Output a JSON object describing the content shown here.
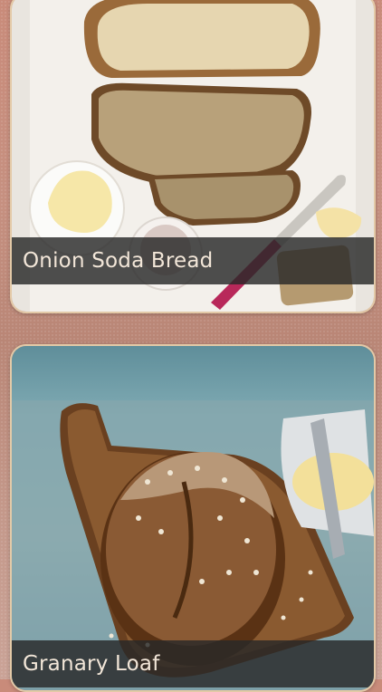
{
  "recipes": [
    {
      "title": "Onion Soda Bread",
      "image_icon": "soda-bread-photo"
    },
    {
      "title": "Granary Loaf",
      "image_icon": "granary-loaf-photo"
    }
  ],
  "colors": {
    "background": "#c69080",
    "card_border": "#e3c9a7",
    "caption_bg": "#282828",
    "caption_text": "#f2e6d8"
  }
}
